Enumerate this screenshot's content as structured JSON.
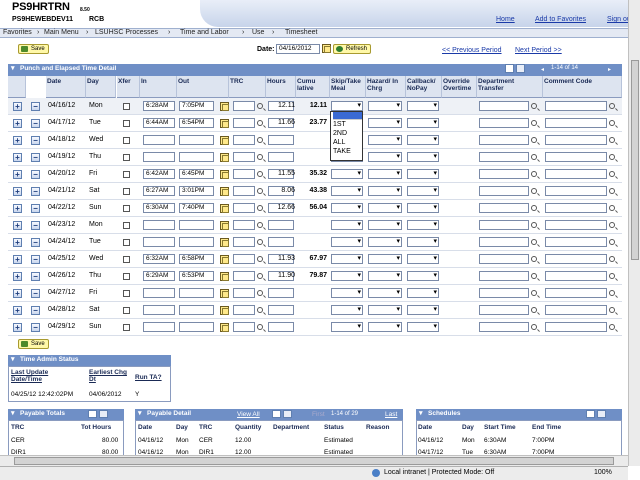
{
  "header": {
    "title": "PS9HRTRN",
    "version": "8.50",
    "subtitle": "PS9HEWEBDEV11",
    "subtitle_b": "RCB",
    "links": [
      "Home",
      "Add to Favorites",
      "Sign out"
    ]
  },
  "breadcrumbs": [
    "Favorites",
    "Main Menu",
    "LSUHSC Processes",
    "Time and Labor",
    "Use",
    "Timesheet"
  ],
  "toolbar": {
    "save_label": "Save",
    "date_label": "Date:",
    "date_value": "04/16/2012",
    "refresh_label": "Refresh",
    "prev_period": "<< Previous Period",
    "next_period": "Next Period >>"
  },
  "grid": {
    "title": "Punch and Elapsed Time Detail",
    "pager": "1-14 of 14",
    "columns": [
      "Date",
      "Day",
      "Xfer",
      "In",
      "Out",
      "TRC",
      "Hours",
      "Cumu lative",
      "Skip/Take Meal",
      "Hazard/ In Chrg",
      "Callback/ NoPay",
      "Override Overtime",
      "Department Transfer",
      "Comment Code"
    ],
    "rows": [
      {
        "date": "04/16/12",
        "day": "Mon",
        "in": "6:28AM",
        "out": "7:05PM",
        "hours": "12.11",
        "cum": "12.11"
      },
      {
        "date": "04/17/12",
        "day": "Tue",
        "in": "6:44AM",
        "out": "6:54PM",
        "hours": "11.66",
        "cum": "23.77"
      },
      {
        "date": "04/18/12",
        "day": "Wed",
        "in": "",
        "out": "",
        "hours": "",
        "cum": ""
      },
      {
        "date": "04/19/12",
        "day": "Thu",
        "in": "",
        "out": "",
        "hours": "",
        "cum": ""
      },
      {
        "date": "04/20/12",
        "day": "Fri",
        "in": "6:42AM",
        "out": "6:45PM",
        "hours": "11.55",
        "cum": "35.32"
      },
      {
        "date": "04/21/12",
        "day": "Sat",
        "in": "6:27AM",
        "out": "3:01PM",
        "hours": "8.06",
        "cum": "43.38"
      },
      {
        "date": "04/22/12",
        "day": "Sun",
        "in": "6:30AM",
        "out": "7:40PM",
        "hours": "12.66",
        "cum": "56.04"
      },
      {
        "date": "04/23/12",
        "day": "Mon",
        "in": "",
        "out": "",
        "hours": "",
        "cum": ""
      },
      {
        "date": "04/24/12",
        "day": "Tue",
        "in": "",
        "out": "",
        "hours": "",
        "cum": ""
      },
      {
        "date": "04/25/12",
        "day": "Wed",
        "in": "6:32AM",
        "out": "6:58PM",
        "hours": "11.93",
        "cum": "67.97"
      },
      {
        "date": "04/26/12",
        "day": "Thu",
        "in": "6:29AM",
        "out": "6:53PM",
        "hours": "11.90",
        "cum": "79.87"
      },
      {
        "date": "04/27/12",
        "day": "Fri",
        "in": "",
        "out": "",
        "hours": "",
        "cum": ""
      },
      {
        "date": "04/28/12",
        "day": "Sat",
        "in": "",
        "out": "",
        "hours": "",
        "cum": ""
      },
      {
        "date": "04/29/12",
        "day": "Sun",
        "in": "",
        "out": "",
        "hours": "",
        "cum": ""
      }
    ],
    "meal_options": [
      "",
      "1ST",
      "2ND",
      "ALL",
      "TAKE"
    ]
  },
  "time_admin": {
    "title": "Time Admin Status",
    "headers": [
      "Last Update Date/Time",
      "Earliest Chg Dt",
      "Run TA?"
    ],
    "values": [
      "04/25/12 12:42:02PM",
      "04/06/2012",
      "Y"
    ]
  },
  "payable_totals": {
    "title": "Payable Totals",
    "headers": [
      "TRC",
      "Tot Hours"
    ],
    "rows": [
      [
        "CER",
        "80.00"
      ],
      [
        "DIR1",
        "80.00"
      ]
    ]
  },
  "payable_detail": {
    "title": "Payable Detail",
    "view_all": "View All",
    "first": "First",
    "pager": "1-14 of 29",
    "last": "Last",
    "headers": [
      "Date",
      "Day",
      "TRC",
      "Quantity",
      "Department",
      "Status",
      "Reason"
    ],
    "rows": [
      [
        "04/16/12",
        "Mon",
        "CER",
        "12.00",
        "",
        "Estimated",
        ""
      ],
      [
        "04/16/12",
        "Mon",
        "DIR1",
        "12.00",
        "",
        "Estimated",
        ""
      ]
    ]
  },
  "schedules": {
    "title": "Schedules",
    "headers": [
      "Date",
      "Day",
      "Start Time",
      "End Time"
    ],
    "rows": [
      [
        "04/16/12",
        "Mon",
        "6:30AM",
        "7:00PM"
      ],
      [
        "04/17/12",
        "Tue",
        "6:30AM",
        "7:00PM"
      ]
    ]
  },
  "statusbar": {
    "zone": "Local intranet | Protected Mode: Off",
    "zoom": "100%"
  }
}
